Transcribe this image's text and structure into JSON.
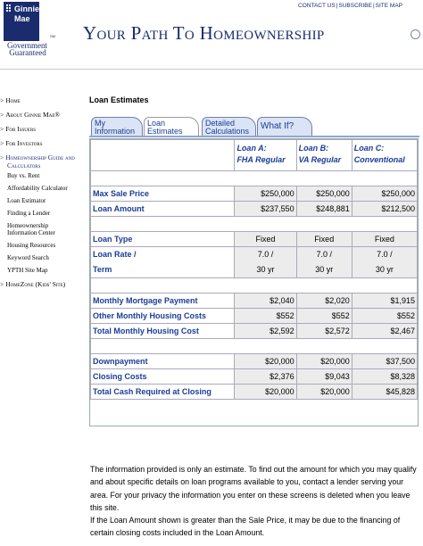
{
  "header": {
    "logo_name": [
      "Ginnie",
      "Mae"
    ],
    "logo_sm": "SM",
    "logo_tagline": [
      "Government",
      "Guaranteed"
    ],
    "links": [
      "CONTACT US",
      "SUBSCRIBE",
      "SITE MAP"
    ],
    "title": "Your Path To Homeownership"
  },
  "sidebar": {
    "main_items": [
      "Home",
      "About Ginnie Mae®",
      "For Issuers",
      "For Investors",
      "Homeownership Guide and Calculators",
      "HomeZone (Kids' Site)"
    ],
    "sub_items": [
      "Buy vs. Rent",
      "Affordability Calculator",
      "Loan Estimator",
      "Finding a Lender",
      "Homeownership Information Center",
      "Housing Resources",
      "Keyword Search",
      "YPTH Site Map"
    ]
  },
  "main": {
    "title": "Loan Estimates",
    "tabs": [
      "My Information",
      "Loan Estimates",
      "Detailed Calculations",
      "What If?"
    ]
  },
  "table": {
    "columns": [
      {
        "name": "Loan A:",
        "type": "FHA Regular"
      },
      {
        "name": "Loan B:",
        "type": "VA Regular"
      },
      {
        "name": "Loan C:",
        "type": "Conventional"
      }
    ],
    "max_sale_price": {
      "label": "Max Sale Price",
      "values": [
        "$250,000",
        "$250,000",
        "$250,000"
      ]
    },
    "loan_amount": {
      "label": "Loan Amount",
      "values": [
        "$237,550",
        "$248,881",
        "$212,500"
      ]
    },
    "loan_type": {
      "label": "Loan Type",
      "values": [
        "Fixed",
        "Fixed",
        "Fixed"
      ]
    },
    "loan_rate": {
      "label": "Loan Rate /",
      "label2": "Term",
      "rates": [
        "7.0 /",
        "7.0 /",
        "7.0 /"
      ],
      "terms": [
        "30 yr",
        "30 yr",
        "30 yr"
      ]
    },
    "monthly_payment": {
      "label": "Monthly Mortgage Payment",
      "values": [
        "$2,040",
        "$2,020",
        "$1,915"
      ]
    },
    "other_costs": {
      "label": "Other Monthly Housing Costs",
      "values": [
        "$552",
        "$552",
        "$552"
      ]
    },
    "total_monthly": {
      "label": "Total Monthly Housing Cost",
      "values": [
        "$2,592",
        "$2,572",
        "$2,467"
      ]
    },
    "downpayment": {
      "label": "Downpayment",
      "values": [
        "$20,000",
        "$20,000",
        "$37,500"
      ]
    },
    "closing_costs": {
      "label": "Closing Costs",
      "values": [
        "$2,376",
        "$9,043",
        "$8,328"
      ]
    },
    "total_cash": {
      "label": "Total Cash Required at Closing",
      "values": [
        "$20,000",
        "$20,000",
        "$45,828"
      ]
    }
  },
  "info": {
    "p1": "The information provided is only an estimate. To find out the amount for which you may qualify and about specific details on loan programs available to you, contact a lender serving your area. For your privacy the information you enter on these screens is deleted when you leave this site.",
    "p2": "If the Loan Amount shown is greater than the Sale Price, it may be due to the financing of certain closing costs included in the Loan Amount."
  }
}
